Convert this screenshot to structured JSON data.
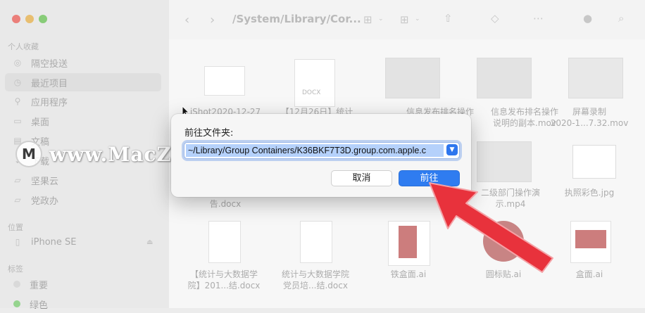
{
  "window": {
    "path_title": "/System/Library/Cor...",
    "toolbar_icons": [
      "back-icon",
      "forward-icon",
      "view-grid-icon",
      "group-icon",
      "share-icon",
      "tag-icon",
      "more-icon",
      "search-icon"
    ]
  },
  "sidebar": {
    "sections": {
      "favorites": "个人收藏",
      "locations": "位置",
      "tags": "标签"
    },
    "favorites": [
      {
        "label": "隔空投送",
        "icon": "airdrop-icon"
      },
      {
        "label": "最近项目",
        "icon": "clock-icon"
      },
      {
        "label": "应用程序",
        "icon": "apps-icon"
      },
      {
        "label": "桌面",
        "icon": "desktop-icon"
      },
      {
        "label": "文稿",
        "icon": "document-icon"
      },
      {
        "label": "下载",
        "icon": "download-icon"
      },
      {
        "label": "坚果云",
        "icon": "folder-icon"
      },
      {
        "label": "党政办",
        "icon": "folder-icon"
      }
    ],
    "locations": [
      {
        "label": "iPhone SE",
        "icon": "phone-icon"
      }
    ],
    "tags": [
      {
        "label": "重要",
        "color": "#c8c8c8"
      },
      {
        "label": "绿色",
        "color": "#5bbd53"
      }
    ]
  },
  "files": {
    "row1": [
      {
        "name": "iShot2020-12-27"
      },
      {
        "name": "【12月26日】统计"
      },
      {
        "name": "信息发布排名操作"
      },
      {
        "name": "信息发布排名操作",
        "name2": "说明的副本.mov"
      },
      {
        "name": "屏幕录制",
        "name2": "2020-1...7.32.mov"
      }
    ],
    "row2": [
      {
        "name": "告.docx"
      },
      {
        "name": "二级部门操作演",
        "name2": "示.mp4"
      },
      {
        "name": "执照彩色.jpg"
      }
    ],
    "row3": [
      {
        "name": "【统计与大数据学",
        "name2": "院】201...结.docx"
      },
      {
        "name": "统计与大数据学院",
        "name2": "党员培...结.docx"
      },
      {
        "name": "铁盒面.ai"
      },
      {
        "name": "圆标贴.ai"
      },
      {
        "name": "盒面.ai"
      }
    ],
    "docx_badge": "DOCX"
  },
  "dialog": {
    "label": "前往文件夹:",
    "path_value": "~/Library/Group Containers/K36BKF7T3D.group.com.apple.c",
    "cancel_label": "取消",
    "go_label": "前往"
  },
  "watermark": {
    "text": "www.MacZ.com"
  },
  "colors": {
    "accent": "#2f7cf0",
    "arrow": "#e8323c"
  }
}
